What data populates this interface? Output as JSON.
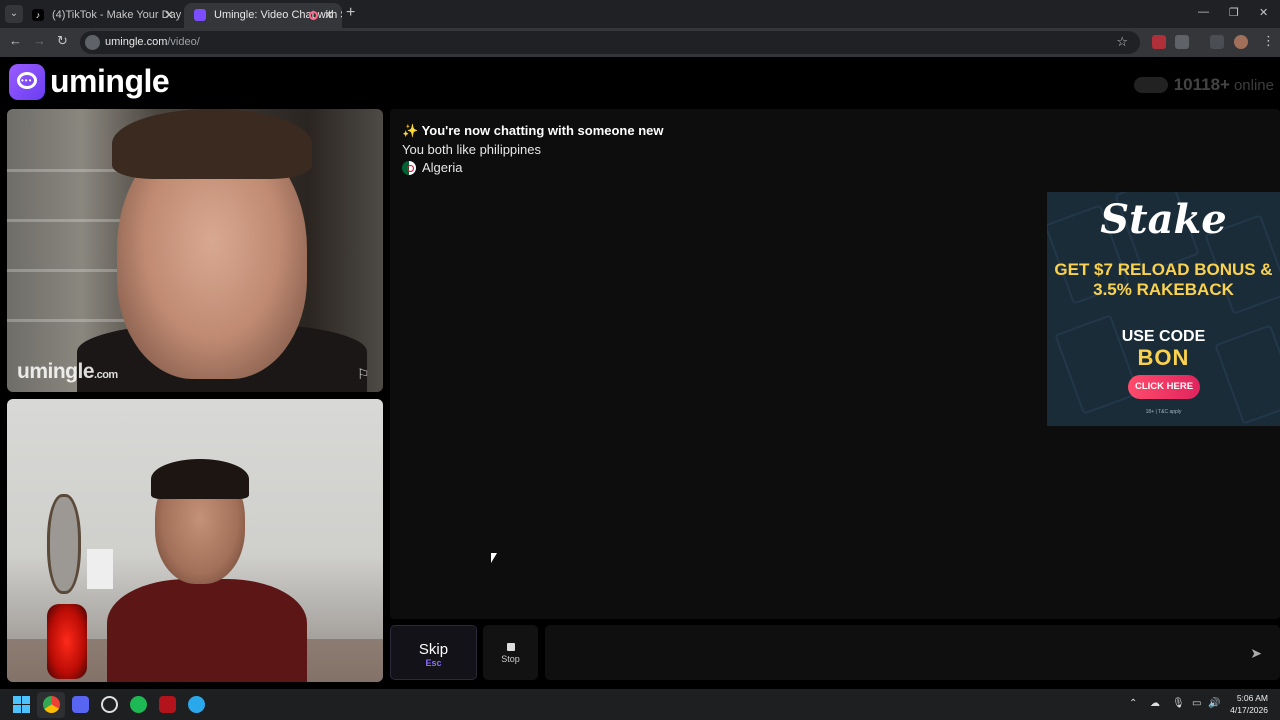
{
  "browser": {
    "tabs": [
      {
        "label": "(4)TikTok - Make Your Day",
        "active": false
      },
      {
        "label": "Umingle: Video Chat with St",
        "active": true
      }
    ],
    "url_host": "umingle.com",
    "url_path": "/video/"
  },
  "header": {
    "logo_text": "umingle",
    "online_count": "10118+",
    "online_label": "online"
  },
  "videos": {
    "stranger_watermark": "umingle",
    "stranger_watermark_suffix": ".com"
  },
  "chat": {
    "title": "✨ You're now chatting with someone new",
    "interest": "You both like philippines",
    "country": "Algeria"
  },
  "ad": {
    "brand": "Stake",
    "headline": "GET $7 RELOAD BONUS & 3.5% RAKEBACK",
    "code_label": "USE CODE",
    "code": "BON",
    "cta": "CLICK HERE",
    "fine_print": "18+ | T&C apply"
  },
  "controls": {
    "skip_label": "Skip",
    "skip_key": "Esc",
    "stop_label": "Stop",
    "message_placeholder": ""
  },
  "taskbar": {
    "time": "5:06 AM",
    "date": "4/17/2026"
  },
  "colors": {
    "brand_purple": "#7b4dff",
    "ad_yellow": "#fbd24d",
    "ad_bg": "#1a2c38"
  }
}
